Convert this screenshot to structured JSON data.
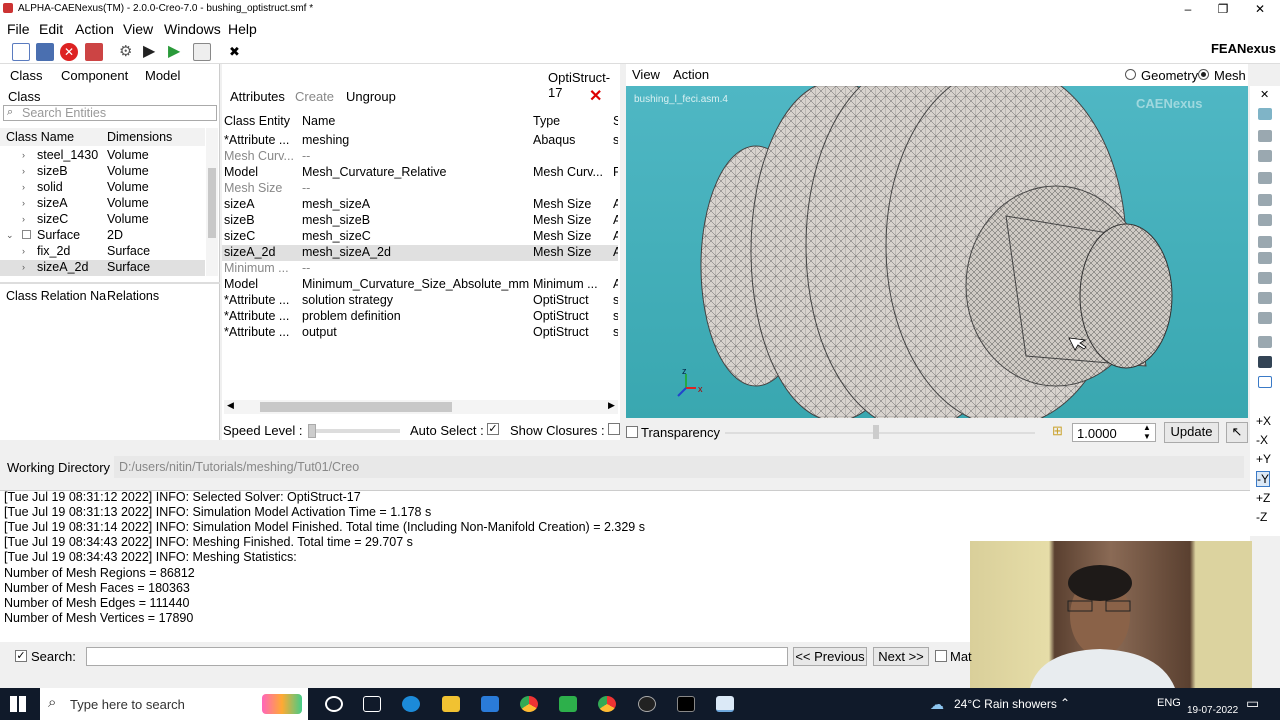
{
  "window": {
    "title": "ALPHA-CAENexus(TM) - 2.0.0-Creo-7.0 - bushing_optistruct.smf *"
  },
  "menu": [
    "File",
    "Edit",
    "Action",
    "View",
    "Windows",
    "Help"
  ],
  "brand": "FEANexus",
  "left": {
    "tabs": [
      "Class",
      "Component",
      "Model"
    ],
    "section_label": "Class",
    "search_placeholder": "Search Entities",
    "headers": {
      "name": "Class Name",
      "dim": "Dimensions"
    },
    "rows": [
      {
        "name": "steel_1430",
        "dim": "Volume"
      },
      {
        "name": "sizeB",
        "dim": "Volume"
      },
      {
        "name": "solid",
        "dim": "Volume"
      },
      {
        "name": "sizeA",
        "dim": "Volume"
      },
      {
        "name": "sizeC",
        "dim": "Volume"
      },
      {
        "name": "Surface",
        "dim": "2D"
      },
      {
        "name": "fix_2d",
        "dim": "Surface"
      },
      {
        "name": "sizeA_2d",
        "dim": "Surface"
      }
    ],
    "relation_headers": {
      "name": "Class Relation Na",
      "rel": "Relations"
    }
  },
  "mid": {
    "solver": "OptiStruct-17",
    "actions": [
      "Attributes",
      "Create",
      "Ungroup"
    ],
    "headers": {
      "entity": "Class Entity",
      "name": "Name",
      "type": "Type",
      "extra": "S"
    },
    "rows": [
      {
        "entity": "*Attribute ...",
        "name": "meshing",
        "type": "Abaqus",
        "extra": "s"
      },
      {
        "entity": "Mesh Curv...",
        "name": "--",
        "type": "",
        "extra": ""
      },
      {
        "entity": "Model",
        "name": "Mesh_Curvature_Relative",
        "type": "Mesh Curv...",
        "extra": "F"
      },
      {
        "entity": "Mesh Size",
        "name": "--",
        "type": "",
        "extra": ""
      },
      {
        "entity": "sizeA",
        "name": "mesh_sizeA",
        "type": "Mesh Size",
        "extra": "A"
      },
      {
        "entity": "sizeB",
        "name": "mesh_sizeB",
        "type": "Mesh Size",
        "extra": "A"
      },
      {
        "entity": "sizeC",
        "name": "mesh_sizeC",
        "type": "Mesh Size",
        "extra": "A"
      },
      {
        "entity": "sizeA_2d",
        "name": "mesh_sizeA_2d",
        "type": "Mesh Size",
        "extra": "A"
      },
      {
        "entity": "Minimum ...",
        "name": "--",
        "type": "",
        "extra": ""
      },
      {
        "entity": "Model",
        "name": "Minimum_Curvature_Size_Absolute_mm",
        "type": "Minimum ...",
        "extra": "A"
      },
      {
        "entity": "*Attribute ...",
        "name": "solution strategy",
        "type": "OptiStruct",
        "extra": "s"
      },
      {
        "entity": "*Attribute ...",
        "name": "problem definition",
        "type": "OptiStruct",
        "extra": "s"
      },
      {
        "entity": "*Attribute ...",
        "name": "output",
        "type": "OptiStruct",
        "extra": "s"
      }
    ]
  },
  "viewport": {
    "menu": [
      "View",
      "Action"
    ],
    "radio_geometry": "Geometry",
    "radio_mesh": "Mesh",
    "file_label": "bushing_l_feci.asm.4",
    "watermark": "CAENexus",
    "axis_z": "z",
    "axis_x": "x"
  },
  "controls": {
    "speed_level": "Speed Level :",
    "auto_select": "Auto Select :",
    "show_closures": "Show Closures :",
    "transparency": "Transparency",
    "scale_value": "1.0000",
    "update": "Update"
  },
  "right_axes": [
    "+X",
    "-X",
    "+Y",
    "-Y",
    "+Z",
    "-Z"
  ],
  "working_dir": {
    "label": "Working Directory",
    "value": "D:/users/nitin/Tutorials/meshing/Tut01/Creo"
  },
  "log": [
    "[Tue Jul 19 08:31:12 2022] INFO:   Selected Solver: OptiStruct-17",
    "[Tue Jul 19 08:31:13 2022] INFO:   Simulation Model Activation Time = 1.178 s",
    "[Tue Jul 19 08:31:14 2022] INFO:   Simulation Model Finished. Total time (Including Non-Manifold Creation) = 2.329 s",
    "[Tue Jul 19 08:34:43 2022] INFO:   Meshing Finished. Total time = 29.707 s",
    "[Tue Jul 19 08:34:43 2022] INFO:   Meshing Statistics:",
    "Number of Mesh Regions  = 86812",
    "Number of Mesh Faces    = 180363",
    "Number of Mesh Edges    = 111440",
    "Number of Mesh Vertices = 17890"
  ],
  "searchbar": {
    "label": "Search:",
    "previous": "<< Previous",
    "next": "Next >>",
    "match": "Mat"
  },
  "taskbar": {
    "search_placeholder": "Type here to search",
    "weather": "24°C  Rain showers",
    "lang": "ENG",
    "date": "19-07-2022"
  },
  "colors": {
    "viewport_bg": "#45b0bb",
    "taskbar": "#101a2a"
  }
}
